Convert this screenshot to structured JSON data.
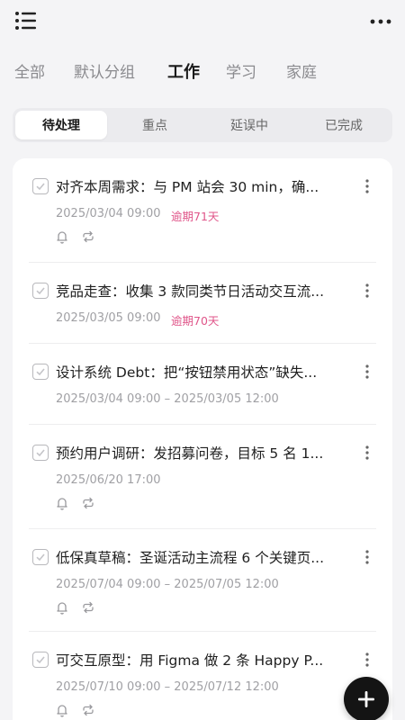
{
  "header": {
    "menu_icon": "list-menu-icon",
    "more_icon": "more-horizontal-icon"
  },
  "groups": [
    {
      "label": "全部",
      "active": false
    },
    {
      "label": "默认分组",
      "active": false
    },
    {
      "label": "工作",
      "active": true
    },
    {
      "label": "学习",
      "active": false
    },
    {
      "label": "家庭",
      "active": false
    }
  ],
  "filters": [
    {
      "label": "待处理",
      "active": true
    },
    {
      "label": "重点",
      "active": false
    },
    {
      "label": "延误中",
      "active": false
    },
    {
      "label": "已完成",
      "active": false
    }
  ],
  "tasks": [
    {
      "title": "对齐本周需求：与 PM 站会 30 min，确...",
      "time": "2025/03/04 09:00",
      "overdue": "逾期71天",
      "reminder": true,
      "repeat": true
    },
    {
      "title": "竞品走查：收集 3 款同类节日活动交互流...",
      "time": "2025/03/05 09:00",
      "overdue": "逾期70天",
      "reminder": false,
      "repeat": false
    },
    {
      "title": "设计系统 Debt：把“按钮禁用状态”缺失...",
      "time": "2025/03/04 09:00 – 2025/03/05 12:00",
      "overdue": "",
      "reminder": false,
      "repeat": false
    },
    {
      "title": "预约用户调研：发招募问卷，目标 5 名 1...",
      "time": "2025/06/20 17:00",
      "overdue": "",
      "reminder": true,
      "repeat": true
    },
    {
      "title": "低保真草稿：圣诞活动主流程 6 个关键页...",
      "time": "2025/07/04 09:00 – 2025/07/05 12:00",
      "overdue": "",
      "reminder": true,
      "repeat": true
    },
    {
      "title": "可交互原型：用 Figma 做 2 条 Happy P...",
      "time": "2025/07/10 09:00 – 2025/07/12 12:00",
      "overdue": "",
      "reminder": true,
      "repeat": true
    }
  ],
  "fab_icon": "plus-icon",
  "colors": {
    "accent": "#141414",
    "overdue": "#e0568a",
    "muted": "#a0a0a4"
  }
}
